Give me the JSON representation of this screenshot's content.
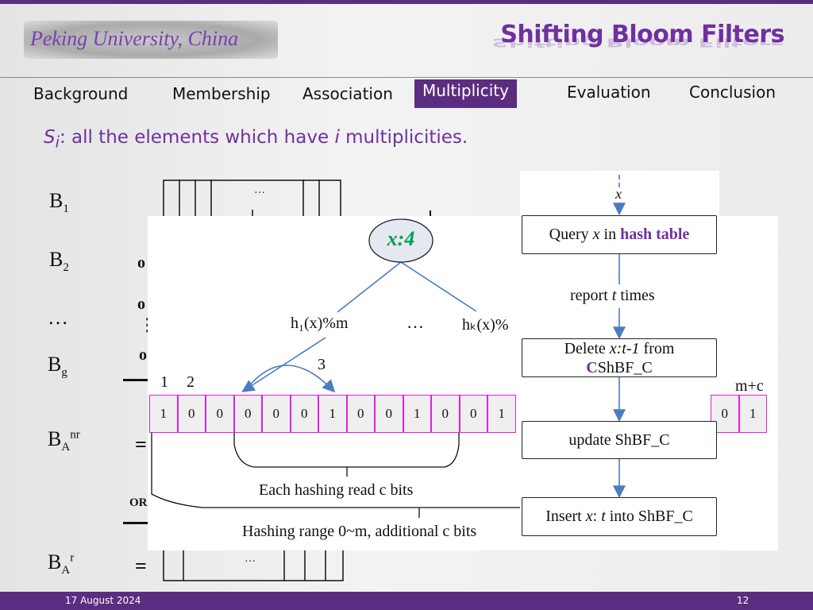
{
  "header": {
    "logo_text": "Peking University, China",
    "title": "Shifting Bloom Filters"
  },
  "nav": {
    "items": [
      "Background",
      "Membership",
      "Association",
      "Multiplicity",
      "Evaluation",
      "Conclusion"
    ],
    "active": "Multiplicity"
  },
  "subtitle": {
    "symbol": "S",
    "sub": "i",
    "text": ": all the elements which have ",
    "ivar": "i",
    "text2": " multiplicities."
  },
  "left_labels": {
    "b1": "B",
    "b1_sub": "1",
    "b2": "B",
    "b2_sub": "2",
    "dots": "…",
    "bg": "B",
    "bg_sub": "g",
    "ba_nr": "B",
    "ba_nr_sub": "A",
    "ba_nr_sup": "nr",
    "ba_r": "B",
    "ba_r_sub": "A",
    "ba_r_sup": "r",
    "or_ops": [
      "o",
      "o",
      "o"
    ],
    "or_label": "OR",
    "eq": "=",
    "vdots": "⋮",
    "ellipsis_b1": "…",
    "ellipsis_bar": "…"
  },
  "diagram": {
    "node": "x:4",
    "h1": "h₁(x)%m",
    "hk": "hₖ(x)%",
    "hdots": "…",
    "shift": "3",
    "idx1": "1",
    "idx2": "2",
    "idx_end": "m+c",
    "bits": [
      "1",
      "0",
      "0",
      "0",
      "0",
      "0",
      "1",
      "0",
      "0",
      "1",
      "0",
      "0",
      "1"
    ],
    "bits_end": [
      "0",
      "1"
    ],
    "brace1": "Each hashing read c bits",
    "brace2": "Hashing range 0~m, additional c bits"
  },
  "flow": {
    "input": "x",
    "query_a": "Query ",
    "query_x": "x",
    "query_b": " in ",
    "query_c": "hash table",
    "report_a": "report ",
    "report_t": "t",
    "report_b": " times",
    "delete_a": "Delete ",
    "delete_x": "x:t-1",
    "delete_b": " from",
    "delete_c": "C",
    "delete_d": "ShBF_C",
    "update": "update ShBF_C",
    "insert_a": "Insert ",
    "insert_x": "x",
    "insert_b": ": ",
    "insert_t": "t",
    "insert_c": " into ShBF_C"
  },
  "footer": {
    "date": "17 August 2024",
    "page": "12"
  },
  "colors": {
    "accent": "#5b2d80",
    "title": "#7030a0",
    "cell_border": "#e020e0",
    "arrow": "#4a7cc0",
    "node_text": "#00a050"
  }
}
